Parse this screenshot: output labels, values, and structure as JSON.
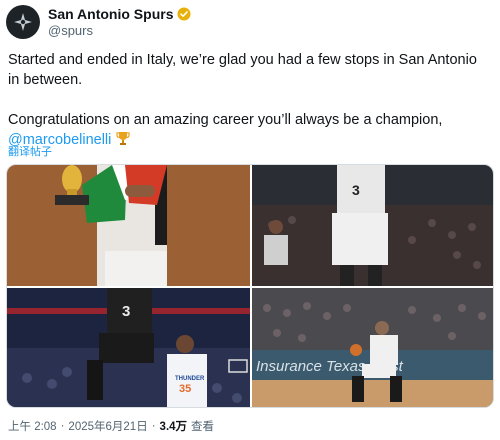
{
  "account": {
    "display_name": "San Antonio Spurs",
    "handle": "@spurs",
    "verified_color": "#e8b10a"
  },
  "tweet": {
    "line1": "Started and ended in Italy, we’re glad you had a few stops in San Antonio in between.",
    "line2": "Congratulations on an amazing career you’ll always be a champion,",
    "mention": "@marcobelinelli",
    "emoji": "trophy-icon",
    "translate_label": "翻译帖子"
  },
  "media": {
    "photos": [
      {
        "name": "photo-trophy-flag",
        "jersey_number": ""
      },
      {
        "name": "photo-player-3-back",
        "jersey_number": "3"
      },
      {
        "name": "photo-player-3-thunder",
        "jersey_number": "3",
        "opponent_number": "35",
        "opponent_text": "THUNDER"
      },
      {
        "name": "photo-player-dribble",
        "banner_text": "Insurance Texas Trust"
      }
    ]
  },
  "meta": {
    "time": "上午 2:08",
    "separator": "·",
    "date": "2025年6月21日",
    "views_count": "3.4万",
    "views_label": "查看"
  },
  "colors": {
    "link": "#1d9bf0",
    "text": "#0f1419",
    "muted": "#536471"
  }
}
